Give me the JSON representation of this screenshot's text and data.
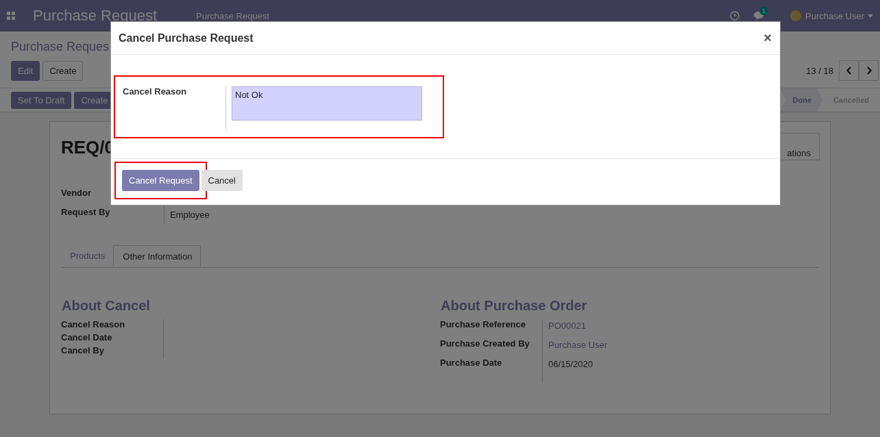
{
  "navbar": {
    "brand": "Purchase Request",
    "menu": [
      "Purchase Request"
    ],
    "notifications": "1",
    "user": "Purchase User"
  },
  "breadcrumb": "Purchase Reques",
  "buttons": [
    {
      "label": "Edit",
      "kind": "primary"
    },
    {
      "label": "Create",
      "kind": "secondary"
    }
  ],
  "pager": "13 / 18",
  "statusbar": {
    "buttons": [
      "Set To Draft",
      "Create"
    ],
    "stages": [
      {
        "label": "Done",
        "selected": true
      },
      {
        "label": "Cancelled",
        "selected": false
      }
    ]
  },
  "sheet": {
    "title": "REQ/0",
    "smart_button": "ations",
    "fields": [
      {
        "label": "Vendor"
      },
      {
        "label": "Request By",
        "value": "Employee"
      }
    ],
    "tabs": [
      {
        "label": "Products",
        "selected": false
      },
      {
        "label": "Other Information",
        "selected": true
      }
    ],
    "groups": [
      {
        "title": "About Cancel",
        "fields": [
          {
            "label": "Cancel Reason"
          },
          {
            "label": "Cancel Date"
          },
          {
            "label": "Cancel By"
          }
        ]
      },
      {
        "title": "About Purchase Order",
        "fields": [
          {
            "label": "Purchase Reference",
            "value": "PO00021",
            "link": true
          },
          {
            "label": "Purchase Created By",
            "value": "Purchase User",
            "link": true
          },
          {
            "label": "Purchase Date",
            "value": "06/15/2020",
            "link": false
          }
        ]
      }
    ]
  },
  "dialog": {
    "title": "Cancel Purchase Request",
    "close": "×",
    "field": {
      "label": "Cancel Reason",
      "value": "Not Ok",
      "highlighted": true
    },
    "buttons": [
      {
        "label": "Cancel Request",
        "kind": "primary",
        "highlighted": true
      },
      {
        "label": "Cancel",
        "kind": "secondary",
        "highlighted": false
      }
    ]
  }
}
